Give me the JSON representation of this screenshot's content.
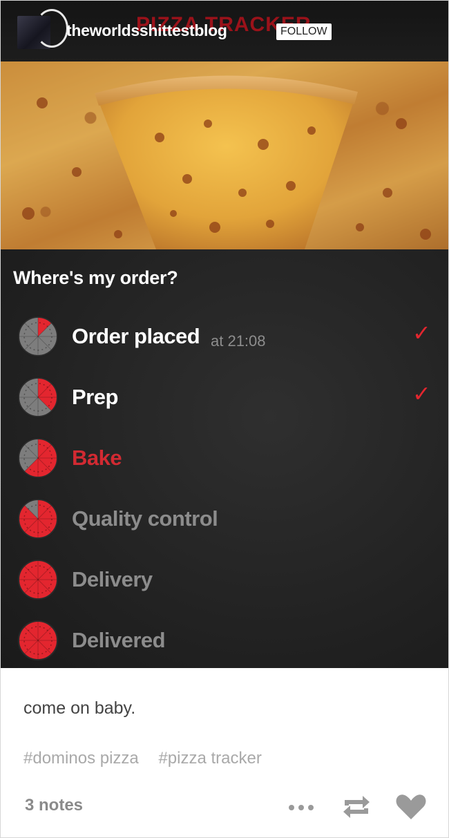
{
  "header": {
    "faded_title": "PIZZA TRACKER",
    "blog_name": "theworldsshittestblog",
    "follow_label": "FOLLOW"
  },
  "tracker": {
    "question": "Where's my order?",
    "steps": [
      {
        "label": "Order placed",
        "time": "at 21:08",
        "status": "done",
        "check": "✓"
      },
      {
        "label": "Prep",
        "time": "",
        "status": "done",
        "check": "✓"
      },
      {
        "label": "Bake",
        "time": "",
        "status": "current",
        "check": ""
      },
      {
        "label": "Quality control",
        "time": "",
        "status": "pending",
        "check": ""
      },
      {
        "label": "Delivery",
        "time": "",
        "status": "pending",
        "check": ""
      },
      {
        "label": "Delivered",
        "time": "",
        "status": "pending",
        "check": ""
      }
    ],
    "progress_fraction": [
      0.125,
      0.375,
      0.625,
      0.875,
      1.0,
      1.0
    ]
  },
  "post": {
    "caption": "come on baby.",
    "tags": [
      "#dominos pizza",
      "#pizza tracker"
    ],
    "notes": "3 notes"
  },
  "colors": {
    "accent_red": "#e3262f",
    "done_label": "#ffffff",
    "current_label": "#d22a32",
    "pending_label": "#8c8c8c"
  },
  "icons": [
    "more-icon",
    "reblog-icon",
    "heart-icon",
    "pizza-progress-icon",
    "check-icon"
  ]
}
